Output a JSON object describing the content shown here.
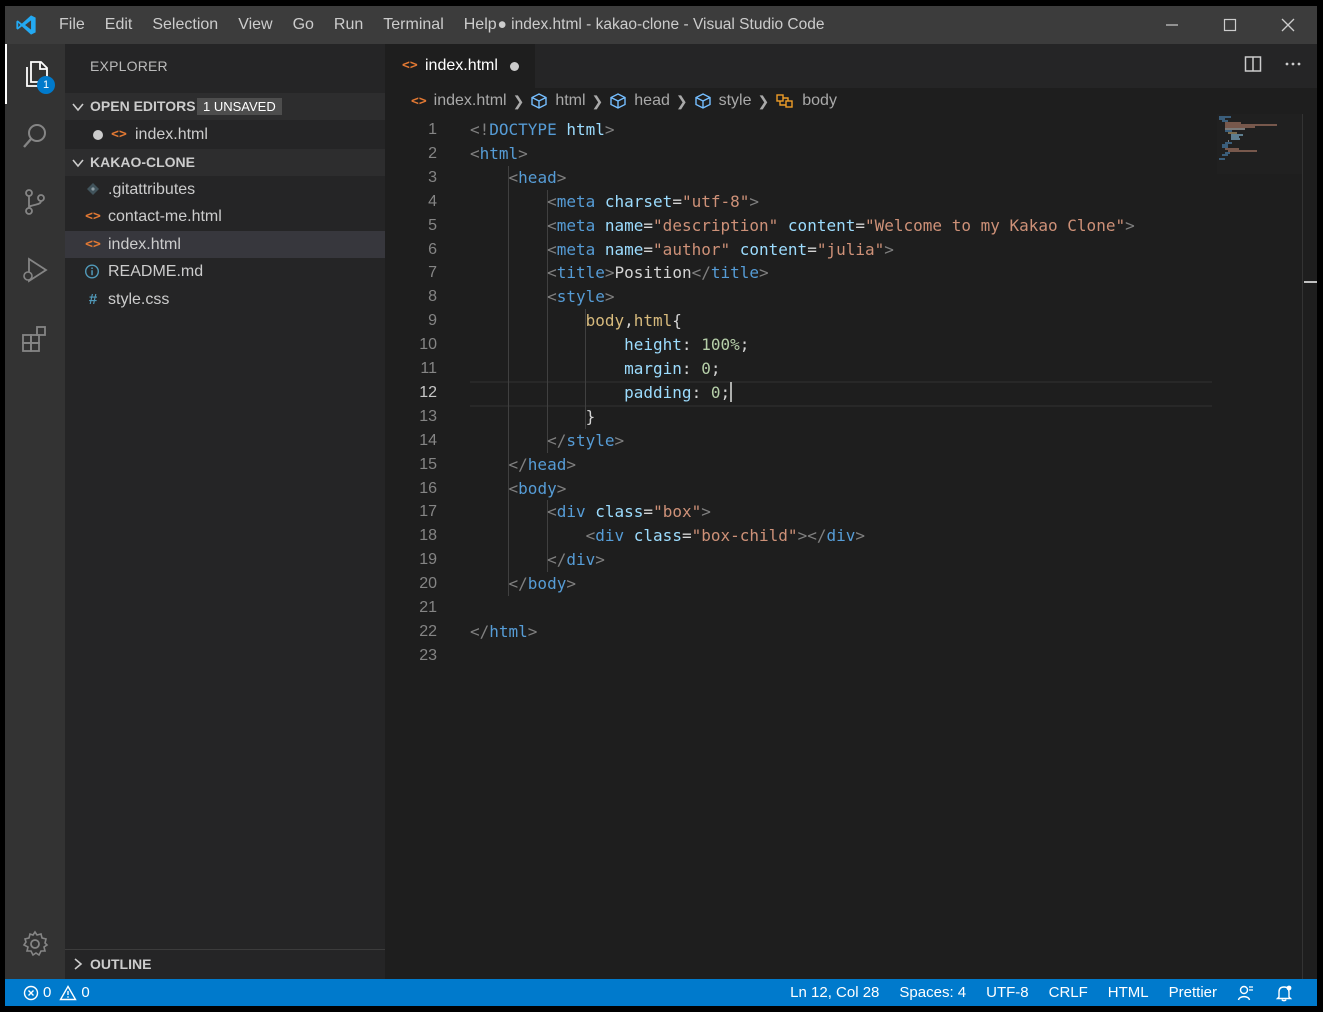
{
  "window": {
    "title": "● index.html - kakao-clone - Visual Studio Code",
    "menu": [
      "File",
      "Edit",
      "Selection",
      "View",
      "Go",
      "Run",
      "Terminal",
      "Help"
    ]
  },
  "activity": {
    "explorer_badge": "1"
  },
  "sidebar": {
    "title": "EXPLORER",
    "open_editors": {
      "label": "OPEN EDITORS",
      "badge": "1 UNSAVED",
      "items": [
        {
          "name": "index.html",
          "icon": "html-icon"
        }
      ]
    },
    "project": {
      "label": "KAKAO-CLONE",
      "files": [
        {
          "name": ".gitattributes",
          "icon": "git-icon"
        },
        {
          "name": "contact-me.html",
          "icon": "html-icon"
        },
        {
          "name": "index.html",
          "icon": "html-icon",
          "selected": true
        },
        {
          "name": "README.md",
          "icon": "info-icon"
        },
        {
          "name": "style.css",
          "icon": "css-hash-icon"
        }
      ]
    },
    "outline_label": "OUTLINE"
  },
  "editor": {
    "tab": {
      "label": "index.html",
      "dirty": true
    },
    "breadcrumb": [
      "index.html",
      "html",
      "head",
      "style",
      "body"
    ],
    "current_line": 12,
    "lines": [
      [
        [
          "<!",
          "punc"
        ],
        [
          "DOCTYPE",
          "tag"
        ],
        [
          " ",
          "text"
        ],
        [
          "html",
          "attr"
        ],
        [
          ">",
          "punc"
        ]
      ],
      [
        [
          "<",
          "punc"
        ],
        [
          "html",
          "tag"
        ],
        [
          ">",
          "punc"
        ]
      ],
      [
        [
          "    ",
          "text"
        ],
        [
          "<",
          "punc"
        ],
        [
          "head",
          "tag"
        ],
        [
          ">",
          "punc"
        ]
      ],
      [
        [
          "        ",
          "text"
        ],
        [
          "<",
          "punc"
        ],
        [
          "meta",
          "tag"
        ],
        [
          " ",
          "text"
        ],
        [
          "charset",
          "attr"
        ],
        [
          "=",
          "text"
        ],
        [
          "\"utf-8\"",
          "str"
        ],
        [
          ">",
          "punc"
        ]
      ],
      [
        [
          "        ",
          "text"
        ],
        [
          "<",
          "punc"
        ],
        [
          "meta",
          "tag"
        ],
        [
          " ",
          "text"
        ],
        [
          "name",
          "attr"
        ],
        [
          "=",
          "text"
        ],
        [
          "\"description\"",
          "str"
        ],
        [
          " ",
          "text"
        ],
        [
          "content",
          "attr"
        ],
        [
          "=",
          "text"
        ],
        [
          "\"Welcome to my Kakao Clone\"",
          "str"
        ],
        [
          ">",
          "punc"
        ]
      ],
      [
        [
          "        ",
          "text"
        ],
        [
          "<",
          "punc"
        ],
        [
          "meta",
          "tag"
        ],
        [
          " ",
          "text"
        ],
        [
          "name",
          "attr"
        ],
        [
          "=",
          "text"
        ],
        [
          "\"author\"",
          "str"
        ],
        [
          " ",
          "text"
        ],
        [
          "content",
          "attr"
        ],
        [
          "=",
          "text"
        ],
        [
          "\"julia\"",
          "str"
        ],
        [
          ">",
          "punc"
        ]
      ],
      [
        [
          "        ",
          "text"
        ],
        [
          "<",
          "punc"
        ],
        [
          "title",
          "tag"
        ],
        [
          ">",
          "punc"
        ],
        [
          "Position",
          "text"
        ],
        [
          "</",
          "punc"
        ],
        [
          "title",
          "tag"
        ],
        [
          ">",
          "punc"
        ]
      ],
      [
        [
          "        ",
          "text"
        ],
        [
          "<",
          "punc"
        ],
        [
          "style",
          "tag"
        ],
        [
          ">",
          "punc"
        ]
      ],
      [
        [
          "            ",
          "text"
        ],
        [
          "body",
          "sel"
        ],
        [
          ",",
          "text"
        ],
        [
          "html",
          "sel"
        ],
        [
          "{",
          "text"
        ]
      ],
      [
        [
          "                ",
          "text"
        ],
        [
          "height",
          "attr"
        ],
        [
          ": ",
          "text"
        ],
        [
          "100%",
          "num"
        ],
        [
          ";",
          "text"
        ]
      ],
      [
        [
          "                ",
          "text"
        ],
        [
          "margin",
          "attr"
        ],
        [
          ": ",
          "text"
        ],
        [
          "0",
          "num"
        ],
        [
          ";",
          "text"
        ]
      ],
      [
        [
          "                ",
          "text"
        ],
        [
          "padding",
          "attr"
        ],
        [
          ": ",
          "text"
        ],
        [
          "0",
          "num"
        ],
        [
          ";",
          "text"
        ]
      ],
      [
        [
          "            ",
          "text"
        ],
        [
          "}",
          "text"
        ]
      ],
      [
        [
          "        ",
          "text"
        ],
        [
          "</",
          "punc"
        ],
        [
          "style",
          "tag"
        ],
        [
          ">",
          "punc"
        ]
      ],
      [
        [
          "    ",
          "text"
        ],
        [
          "</",
          "punc"
        ],
        [
          "head",
          "tag"
        ],
        [
          ">",
          "punc"
        ]
      ],
      [
        [
          "    ",
          "text"
        ],
        [
          "<",
          "punc"
        ],
        [
          "body",
          "tag"
        ],
        [
          ">",
          "punc"
        ]
      ],
      [
        [
          "        ",
          "text"
        ],
        [
          "<",
          "punc"
        ],
        [
          "div",
          "tag"
        ],
        [
          " ",
          "text"
        ],
        [
          "class",
          "attr"
        ],
        [
          "=",
          "text"
        ],
        [
          "\"box\"",
          "str"
        ],
        [
          ">",
          "punc"
        ]
      ],
      [
        [
          "            ",
          "text"
        ],
        [
          "<",
          "punc"
        ],
        [
          "div",
          "tag"
        ],
        [
          " ",
          "text"
        ],
        [
          "class",
          "attr"
        ],
        [
          "=",
          "text"
        ],
        [
          "\"box-child\"",
          "str"
        ],
        [
          "></",
          "punc"
        ],
        [
          "div",
          "tag"
        ],
        [
          ">",
          "punc"
        ]
      ],
      [
        [
          "        ",
          "text"
        ],
        [
          "</",
          "punc"
        ],
        [
          "div",
          "tag"
        ],
        [
          ">",
          "punc"
        ]
      ],
      [
        [
          "    ",
          "text"
        ],
        [
          "</",
          "punc"
        ],
        [
          "body",
          "tag"
        ],
        [
          ">",
          "punc"
        ]
      ],
      [],
      [
        [
          "</",
          "punc"
        ],
        [
          "html",
          "tag"
        ],
        [
          ">",
          "punc"
        ]
      ],
      []
    ]
  },
  "status": {
    "errors": "0",
    "warnings": "0",
    "position": "Ln 12, Col 28",
    "spaces": "Spaces: 4",
    "encoding": "UTF-8",
    "eol": "CRLF",
    "language": "HTML",
    "formatter": "Prettier"
  },
  "colors": {
    "accent": "#007acc",
    "tag": "#569cd6",
    "attribute": "#9cdcfe",
    "string": "#ce9178",
    "selector": "#d7ba7d",
    "number": "#b5cea8",
    "html_icon": "#e37933"
  }
}
